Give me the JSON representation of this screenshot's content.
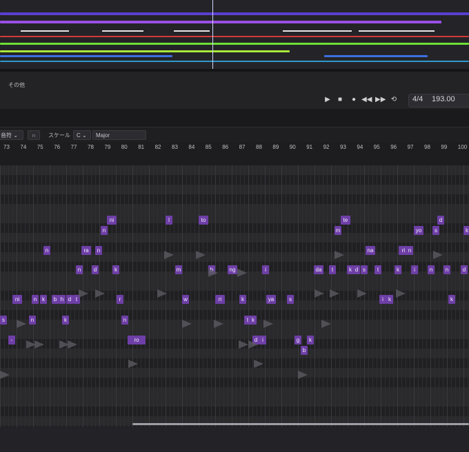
{
  "panel": {
    "label": "その他"
  },
  "transport": {
    "play_icon": "play-icon",
    "stop_icon": "stop-icon",
    "record_icon": "record-icon",
    "rewind_icon": "rewind-icon",
    "forward_icon": "fast-forward-icon",
    "loop_icon": "loop-icon",
    "time_signature": "4/4",
    "tempo": "193.00"
  },
  "toolbar": {
    "mode_label": "音符",
    "magnet_icon": "magnet-icon",
    "scale_label": "スケール",
    "key": "C",
    "scale": "Major"
  },
  "ruler": {
    "measures": [
      "73",
      "74",
      "75",
      "76",
      "77",
      "78",
      "79",
      "80",
      "81",
      "82",
      "83",
      "84",
      "85",
      "86",
      "87",
      "88",
      "89",
      "90",
      "91",
      "92",
      "93",
      "94",
      "95",
      "96",
      "97",
      "98",
      "99",
      "100"
    ]
  },
  "notes": [
    {
      "t": "ni"
    },
    {
      "t": "n"
    },
    {
      "t": "l"
    },
    {
      "t": "to"
    },
    {
      "t": "te"
    },
    {
      "t": "m"
    },
    {
      "t": "yo"
    },
    {
      "t": "s"
    },
    {
      "t": "d"
    },
    {
      "t": "k"
    },
    {
      "t": "n"
    },
    {
      "t": "ra"
    },
    {
      "t": "n"
    },
    {
      "t": "na"
    },
    {
      "t": "ri"
    },
    {
      "t": "n"
    },
    {
      "t": "n"
    },
    {
      "t": "d"
    },
    {
      "t": "k"
    },
    {
      "t": "m"
    },
    {
      "t": "b"
    },
    {
      "t": "ng"
    },
    {
      "t": "i"
    },
    {
      "t": "da"
    },
    {
      "t": "t"
    },
    {
      "t": "k"
    },
    {
      "t": "d"
    },
    {
      "t": "s"
    },
    {
      "t": "t"
    },
    {
      "t": "k"
    },
    {
      "t": "i"
    },
    {
      "t": "n"
    },
    {
      "t": "n"
    },
    {
      "t": "d"
    },
    {
      "t": "ni"
    },
    {
      "t": "n"
    },
    {
      "t": "k"
    },
    {
      "t": "b"
    },
    {
      "t": "h"
    },
    {
      "t": "d"
    },
    {
      "t": "t"
    },
    {
      "t": "r"
    },
    {
      "t": "w"
    },
    {
      "t": "ri"
    },
    {
      "t": "k"
    },
    {
      "t": "ya"
    },
    {
      "t": "s"
    },
    {
      "t": "i"
    },
    {
      "t": "k"
    },
    {
      "t": "k"
    },
    {
      "t": "s"
    },
    {
      "t": "n"
    },
    {
      "t": "k"
    },
    {
      "t": "n"
    },
    {
      "t": "t"
    },
    {
      "t": "k"
    },
    {
      "t": "-"
    },
    {
      "t": "ro"
    },
    {
      "t": "d"
    },
    {
      "t": "i"
    },
    {
      "t": "g"
    },
    {
      "t": "k"
    },
    {
      "t": "b"
    }
  ]
}
